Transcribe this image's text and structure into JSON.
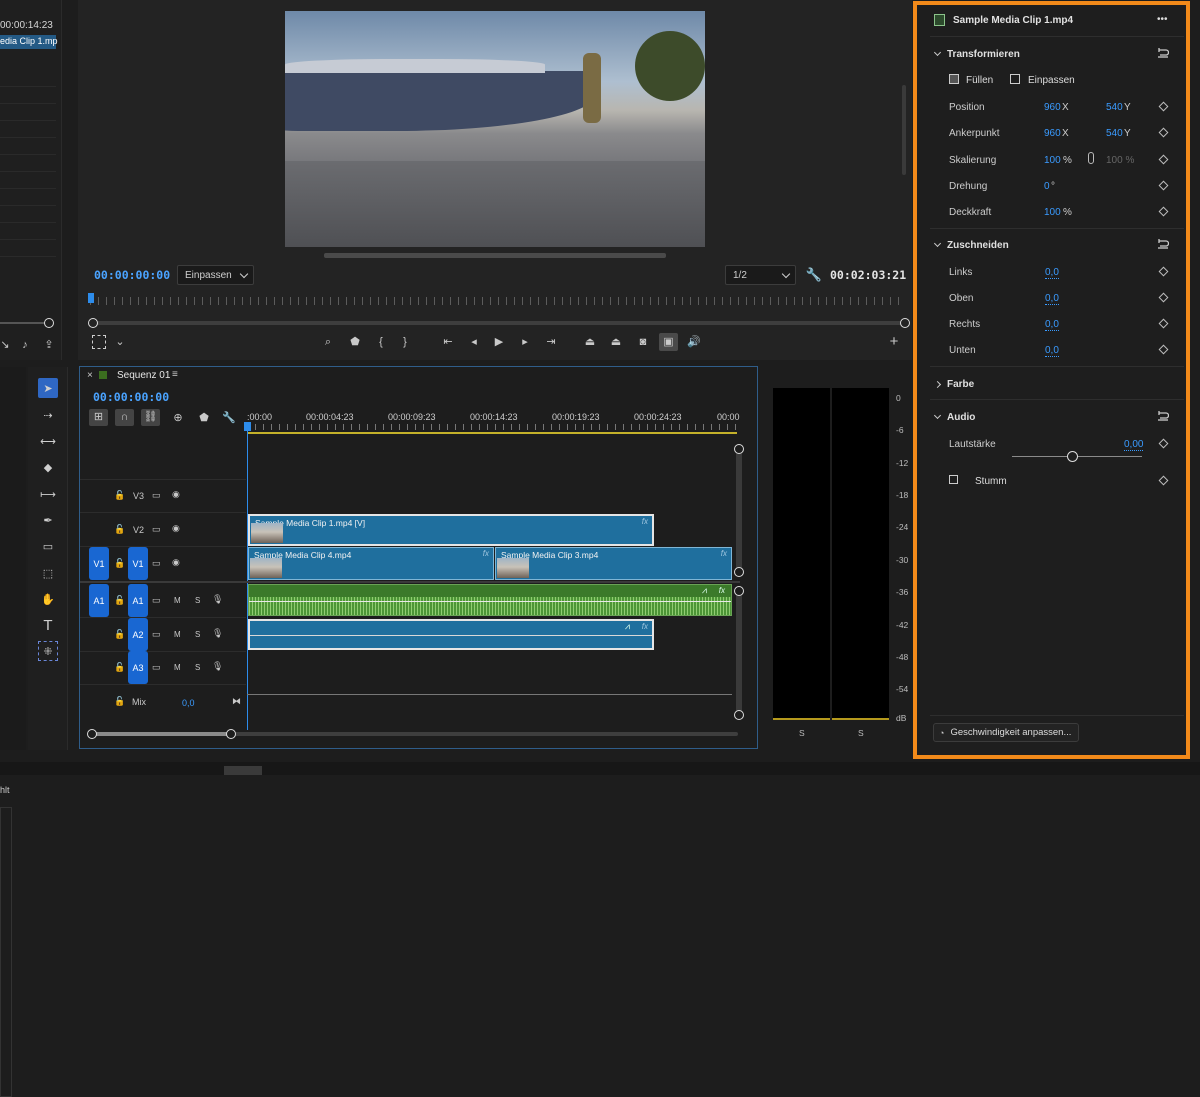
{
  "source_panel": {
    "timecode": "00:00:14:23",
    "clip_name": "edia Clip 1.mp"
  },
  "program": {
    "timecode_current": "00:00:00:00",
    "fit_select": "Einpassen",
    "resolution_select": "1/2",
    "timecode_duration": "00:02:03:21"
  },
  "sequence": {
    "tab_name": "Sequenz 01",
    "timecode": "00:00:00:00",
    "ruler_labels": [
      ":00:00",
      "00:00:04:23",
      "00:00:09:23",
      "00:00:14:23",
      "00:00:19:23",
      "00:00:24:23",
      "00:00"
    ],
    "tracks": {
      "v3": "V3",
      "v2": "V2",
      "v1_src": "V1",
      "v1": "V1",
      "a1_src": "A1",
      "a1": "A1",
      "a2": "A2",
      "a3": "A3",
      "m": "M",
      "s": "S",
      "mix_label": "Mix",
      "mix_value": "0,0"
    },
    "clips": {
      "v2_clip": "Sample Media Clip 1.mp4 [V]",
      "v1_clip_a": "Sample Media Clip 4.mp4",
      "v1_clip_b": "Sample Media Clip 3.mp4",
      "fx": "fx"
    }
  },
  "meter": {
    "db_labels": [
      "0",
      "-6",
      "-12",
      "-18",
      "-24",
      "-30",
      "-36",
      "-42",
      "-48",
      "-54",
      "dB"
    ],
    "solo_labels": [
      "S",
      "S"
    ]
  },
  "effect_controls": {
    "clip_name": "Sample Media Clip 1.mp4",
    "more": "•••",
    "transform": {
      "title": "Transformieren",
      "fill": "Füllen",
      "fit": "Einpassen",
      "position_label": "Position",
      "position_x": "960",
      "position_y": "540",
      "anchor_label": "Ankerpunkt",
      "anchor_x": "960",
      "anchor_y": "540",
      "scale_label": "Skalierung",
      "scale_value": "100",
      "scale_unit": "%",
      "scale_width": "100 %",
      "rotation_label": "Drehung",
      "rotation_value": "0",
      "rotation_unit": "°",
      "opacity_label": "Deckkraft",
      "opacity_value": "100",
      "opacity_unit": "%",
      "x_unit": "X",
      "y_unit": "Y"
    },
    "crop": {
      "title": "Zuschneiden",
      "left_label": "Links",
      "left_value": "0,0",
      "top_label": "Oben",
      "top_value": "0,0",
      "right_label": "Rechts",
      "right_value": "0,0",
      "bottom_label": "Unten",
      "bottom_value": "0,0"
    },
    "color": {
      "title": "Farbe"
    },
    "audio": {
      "title": "Audio",
      "volume_label": "Lautstärke",
      "volume_value": "0,00",
      "mute_label": "Stumm"
    },
    "speed_button": "Geschwindigkeit anpassen..."
  },
  "colors": {
    "accent": "#2d8ceb",
    "highlight_border": "#f28a1a",
    "track_button": "#1967d2",
    "video_clip": "#1f6f9e",
    "audio_clip": "#3b7a2a"
  }
}
